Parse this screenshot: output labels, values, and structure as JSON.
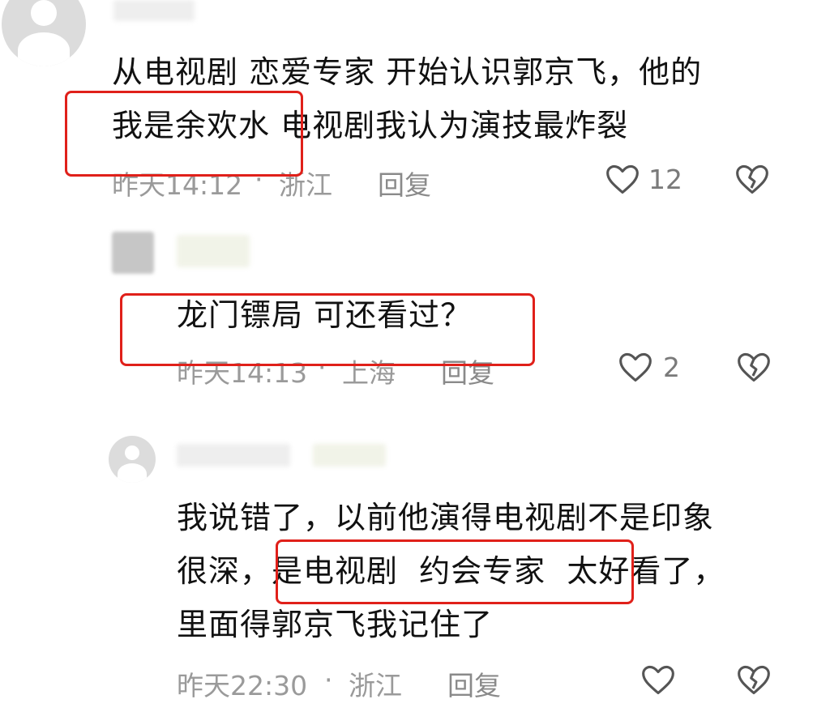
{
  "comments": [
    {
      "text_lines": [
        "从电视剧 恋爱专家 开始认识郭京飞，他的",
        "我是余欢水 电视剧我认为演技最炸裂"
      ],
      "time": "昨天14:12",
      "location": "浙江",
      "reply_label": "回复",
      "like_count": "12"
    },
    {
      "text_lines": [
        "龙门镖局 可还看过？"
      ],
      "time": "昨天14:13",
      "location": "上海",
      "reply_label": "回复",
      "like_count": "2"
    },
    {
      "text_lines": [
        "我说错了，以前他演得电视剧不是印象",
        "很深，是电视剧  约会专家  太好看了，",
        "里面得郭京飞我记住了"
      ],
      "time": "昨天22:30",
      "location": "浙江",
      "reply_label": "回复",
      "like_count": ""
    }
  ],
  "meta_separator": "·",
  "icons": {
    "like": "heart-outline-icon",
    "dislike": "broken-heart-icon"
  },
  "colors": {
    "highlight_box": "#e0201a",
    "meta_text": "#9a9a9a",
    "body_text": "#111111"
  }
}
